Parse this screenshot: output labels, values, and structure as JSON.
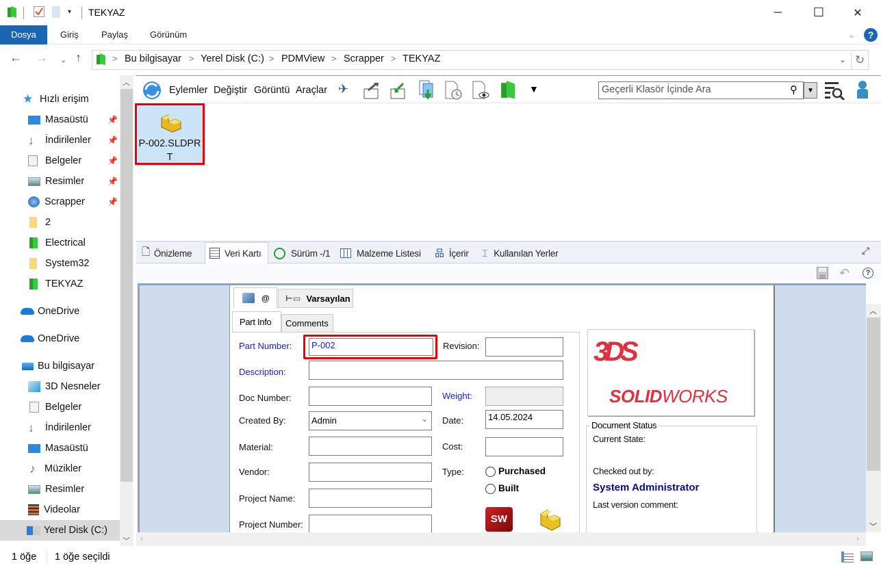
{
  "window": {
    "title": "TEKYAZ",
    "minimize": "─",
    "maximize": "☐",
    "close": "✕"
  },
  "ribbon": {
    "tabs": [
      "Dosya",
      "Giriş",
      "Paylaş",
      "Görünüm"
    ],
    "help": "?"
  },
  "address": {
    "crumbs": [
      "Bu bilgisayar",
      "Yerel Disk (C:)",
      "PDMView",
      "Scrapper",
      "TEKYAZ"
    ],
    "separator": ">"
  },
  "sidebar": {
    "quick_access": "Hızlı erişim",
    "pinned": [
      "Masaüstü",
      "İndirilenler",
      "Belgeler",
      "Resimler",
      "Scrapper"
    ],
    "folders": [
      "2",
      "Electrical",
      "System32",
      "TEKYAZ"
    ],
    "onedrive": [
      "OneDrive",
      "OneDrive"
    ],
    "this_pc": "Bu bilgisayar",
    "pc_items": [
      "3D Nesneler",
      "Belgeler",
      "İndirilenler",
      "Masaüstü",
      "Müzikler",
      "Resimler",
      "Videolar",
      "Yerel Disk (C:)"
    ]
  },
  "pdm_toolbar": {
    "menus": [
      "Eylemler",
      "Değiştir",
      "Görüntü",
      "Araçlar"
    ],
    "search_placeholder": "Geçerli Klasör İçinde Ara"
  },
  "files": [
    {
      "name": "P-002.SLDPRT",
      "line1": "P-002.SLDPR",
      "line2": "T",
      "selected": true
    }
  ],
  "preview_tabs": [
    "Önizleme",
    "Veri Kartı",
    "Sürüm -/1",
    "Malzeme Listesi",
    "İçerir",
    "Kullanılan Yerler"
  ],
  "active_preview_tab": "Veri Kartı",
  "card": {
    "config_tabs": [
      "@",
      "Varsayılan"
    ],
    "inner_tabs": [
      "Part Info",
      "Comments"
    ],
    "fields": {
      "part_number": {
        "label": "Part Number:",
        "value": "P-002"
      },
      "revision": {
        "label": "Revision:",
        "value": ""
      },
      "description": {
        "label": "Description:",
        "value": ""
      },
      "doc_number": {
        "label": "Doc Number:",
        "value": ""
      },
      "weight": {
        "label": "Weight:",
        "value": ""
      },
      "created_by": {
        "label": "Created By:",
        "value": "Admin"
      },
      "date": {
        "label": "Date:",
        "value": "14.05.2024"
      },
      "material": {
        "label": "Material:",
        "value": ""
      },
      "cost": {
        "label": "Cost:",
        "value": ""
      },
      "vendor": {
        "label": "Vendor:",
        "value": ""
      },
      "type": {
        "label": "Type:",
        "options": [
          "Purchased",
          "Built"
        ]
      },
      "project_name": {
        "label": "Project Name:",
        "value": ""
      },
      "project_number": {
        "label": "Project Number:",
        "value": ""
      }
    },
    "logo": {
      "brand_bold": "SOLID",
      "brand_light": "WORKS",
      "mark": "3DS"
    },
    "doc_status": {
      "title": "Document Status",
      "current_state_label": "Current State:",
      "current_state": "",
      "checked_out_label": "Checked out by:",
      "checked_out_by": "System Administrator",
      "last_comment_label": "Last version comment:"
    },
    "sw_badge": "SW"
  },
  "status_bar": {
    "count": "1 öğe",
    "selected": "1 öğe seçildi"
  },
  "colors": {
    "accent": "#1a66b3",
    "highlight_red": "#e00000",
    "brand_red": "#e0313f",
    "label_blue": "#1a1ad0",
    "status_navy": "#0a0a80"
  }
}
